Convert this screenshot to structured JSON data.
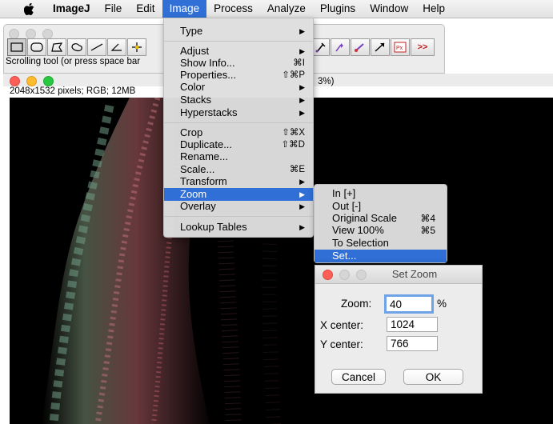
{
  "menubar": {
    "app": "ImageJ",
    "items": [
      "File",
      "Edit",
      "Image",
      "Process",
      "Analyze",
      "Plugins",
      "Window",
      "Help"
    ]
  },
  "toolbar": {
    "status": "Scrolling tool (or press space bar",
    "more_label": ">>"
  },
  "image_window": {
    "info": "2048x1532 pixels; RGB; 12MB",
    "title_fragment": "3%)"
  },
  "image_menu": {
    "items": [
      {
        "label": "Type",
        "submenu": true
      },
      {
        "label": "Adjust",
        "submenu": true
      },
      {
        "label": "Show Info...",
        "shortcut": "⌘I"
      },
      {
        "label": "Properties...",
        "shortcut": "⇧⌘P"
      },
      {
        "label": "Color",
        "submenu": true
      },
      {
        "label": "Stacks",
        "submenu": true
      },
      {
        "label": "Hyperstacks",
        "submenu": true
      },
      {
        "label": "Crop",
        "shortcut": "⇧⌘X"
      },
      {
        "label": "Duplicate...",
        "shortcut": "⇧⌘D"
      },
      {
        "label": "Rename..."
      },
      {
        "label": "Scale...",
        "shortcut": "⌘E"
      },
      {
        "label": "Transform",
        "submenu": true
      },
      {
        "label": "Zoom",
        "submenu": true,
        "highlighted": true
      },
      {
        "label": "Overlay",
        "submenu": true
      },
      {
        "label": "Lookup Tables",
        "submenu": true
      }
    ]
  },
  "zoom_submenu": {
    "items": [
      {
        "label": "In [+]"
      },
      {
        "label": "Out [-]"
      },
      {
        "label": "Original Scale",
        "shortcut": "⌘4"
      },
      {
        "label": "View 100%",
        "shortcut": "⌘5"
      },
      {
        "label": "To Selection"
      },
      {
        "label": "Set...",
        "highlighted": true
      }
    ]
  },
  "dialog": {
    "title": "Set Zoom",
    "zoom_label": "Zoom:",
    "zoom_value": "40",
    "zoom_unit": "%",
    "xcenter_label": "X center:",
    "xcenter_value": "1024",
    "ycenter_label": "Y center:",
    "ycenter_value": "766",
    "cancel_label": "Cancel",
    "ok_label": "OK"
  },
  "colors": {
    "highlight": "#2f6fd6",
    "focus_ring": "#6fa3e8"
  }
}
